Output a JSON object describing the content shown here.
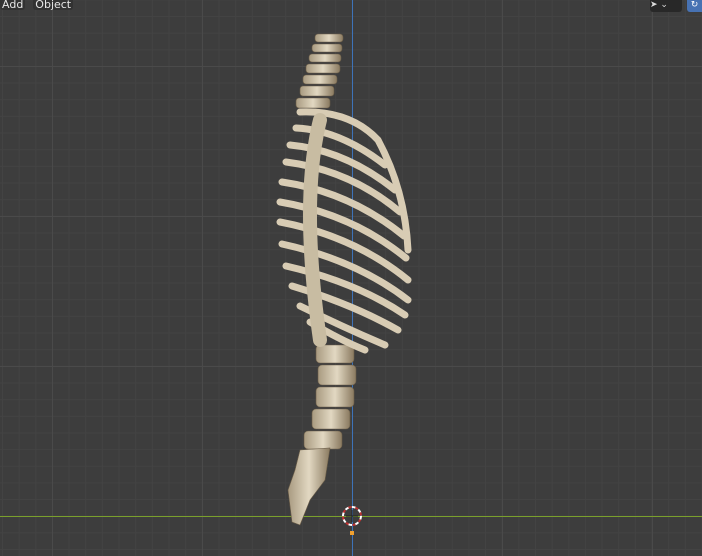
{
  "header": {
    "menu": [
      {
        "label": "Add"
      },
      {
        "label": "Object"
      }
    ]
  },
  "icons": {
    "tool": "select-cursor-icon",
    "dropdown": "chevron-down-icon",
    "gizmo": "transform-gizmo-icon"
  },
  "colors": {
    "x_axis": "#7aa02c",
    "y_axis": "#3e73b8",
    "bone": "#d8ccb4",
    "background": "#3d3d3d"
  }
}
